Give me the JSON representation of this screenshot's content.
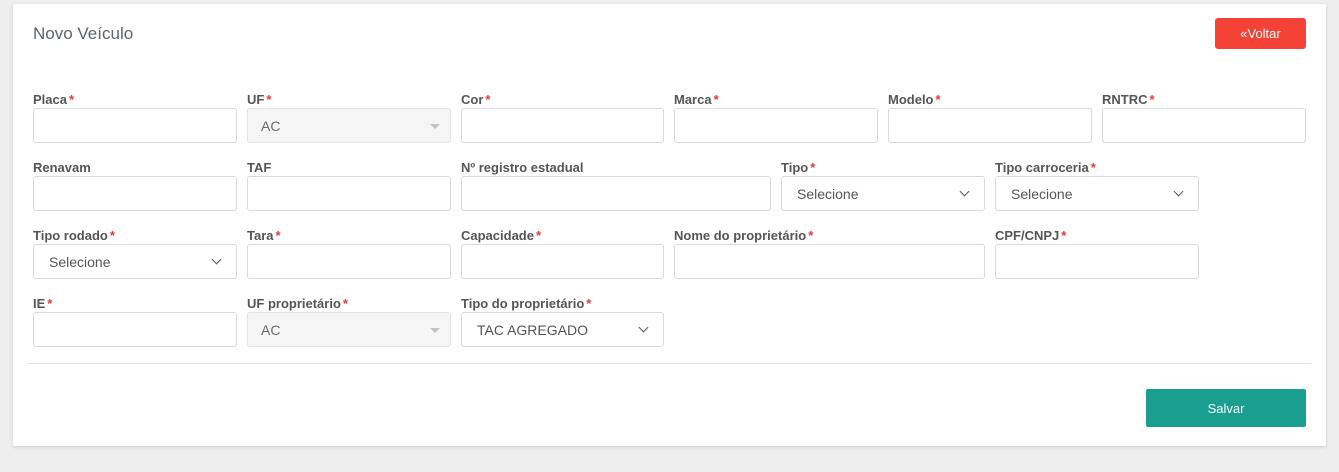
{
  "header": {
    "title": "Novo Veículo",
    "back_label": "Voltar"
  },
  "required_mark": "*",
  "fields": {
    "placa": {
      "label": "Placa",
      "required": true,
      "value": ""
    },
    "uf": {
      "label": "UF",
      "required": true,
      "value": "AC"
    },
    "cor": {
      "label": "Cor",
      "required": true,
      "value": ""
    },
    "marca": {
      "label": "Marca",
      "required": true,
      "value": ""
    },
    "modelo": {
      "label": "Modelo",
      "required": true,
      "value": ""
    },
    "rntrc": {
      "label": "RNTRC",
      "required": true,
      "value": ""
    },
    "renavam": {
      "label": "Renavam",
      "required": false,
      "value": ""
    },
    "taf": {
      "label": "TAF",
      "required": false,
      "value": ""
    },
    "registro_estadual": {
      "label": "Nº registro estadual",
      "required": false,
      "value": ""
    },
    "tipo": {
      "label": "Tipo",
      "required": true,
      "value": "Selecione"
    },
    "tipo_carroceria": {
      "label": "Tipo carroceria",
      "required": true,
      "value": "Selecione"
    },
    "tipo_rodado": {
      "label": "Tipo rodado",
      "required": true,
      "value": "Selecione"
    },
    "tara": {
      "label": "Tara",
      "required": true,
      "value": ""
    },
    "capacidade": {
      "label": "Capacidade",
      "required": true,
      "value": ""
    },
    "nome_proprietario": {
      "label": "Nome do proprietário",
      "required": true,
      "value": ""
    },
    "cpf_cnpj": {
      "label": "CPF/CNPJ",
      "required": true,
      "value": ""
    },
    "ie": {
      "label": "IE",
      "required": true,
      "value": ""
    },
    "uf_proprietario": {
      "label": "UF proprietário",
      "required": true,
      "value": "AC"
    },
    "tipo_proprietario": {
      "label": "Tipo do proprietário",
      "required": true,
      "value": "TAC AGREGADO"
    }
  },
  "footer": {
    "save_label": "Salvar"
  },
  "colors": {
    "danger": "#f44336",
    "primary": "#1a9e8f",
    "required": "#e53935"
  }
}
